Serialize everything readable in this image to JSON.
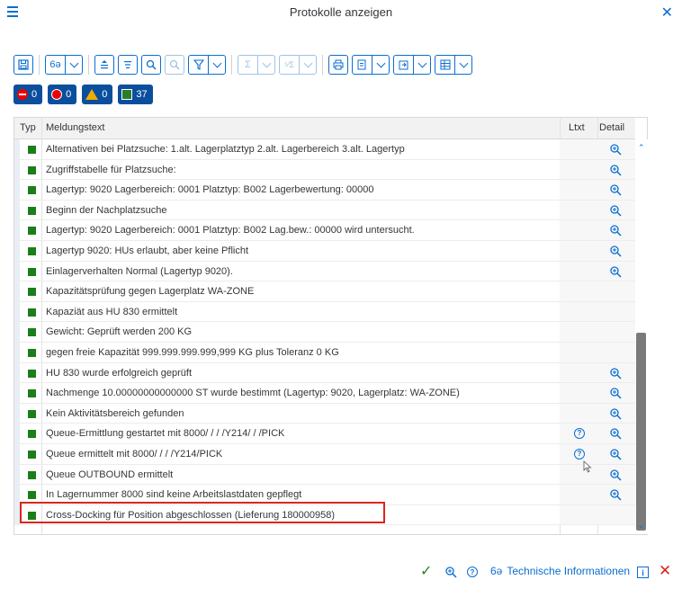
{
  "title": "Protokolle anzeigen",
  "icons": {
    "menu": "hamburger-menu-icon",
    "close": "close-icon",
    "detail": "magnifier-icon",
    "longtext": "help-circle-icon"
  },
  "status_counts": {
    "abort": "0",
    "error": "0",
    "warning": "0",
    "success": "37"
  },
  "table": {
    "headers": {
      "typ": "Typ",
      "text": "Meldungstext",
      "ltxt": "Ltxt",
      "detail": "Detail"
    },
    "rows": [
      {
        "text": "Alternativen bei Platzsuche: 1.alt. Lagerplatztyp 2.alt. Lagerbereich 3.alt. Lagertyp",
        "ltxt": false,
        "detail": true
      },
      {
        "text": "Zugriffstabelle für Platzsuche:",
        "ltxt": false,
        "detail": true
      },
      {
        "text": "Lagertyp: 9020 Lagerbereich: 0001 Platztyp: B002 Lagerbewertung: 00000",
        "ltxt": false,
        "detail": true
      },
      {
        "text": "Beginn der Nachplatzsuche",
        "ltxt": false,
        "detail": true
      },
      {
        "text": "Lagertyp: 9020 Lagerbereich: 0001 Platztyp: B002 Lag.bew.: 00000 wird untersucht.",
        "ltxt": false,
        "detail": true
      },
      {
        "text": "Lagertyp 9020: HUs erlaubt, aber keine Pflicht",
        "ltxt": false,
        "detail": true
      },
      {
        "text": "Einlagerverhalten Normal (Lagertyp 9020).",
        "ltxt": false,
        "detail": true
      },
      {
        "text": "Kapazitätsprüfung gegen Lagerplatz WA-ZONE",
        "ltxt": false,
        "detail": false
      },
      {
        "text": "Kapaziät aus HU 830 ermittelt",
        "ltxt": false,
        "detail": false
      },
      {
        "text": "Gewicht: Geprüft werden 200 KG",
        "ltxt": false,
        "detail": false
      },
      {
        "text": "gegen freie Kapazität 999.999.999.999,999 KG plus Toleranz 0 KG",
        "ltxt": false,
        "detail": false
      },
      {
        "text": "HU 830 wurde erfolgreich geprüft",
        "ltxt": false,
        "detail": true
      },
      {
        "text": "Nachmenge 10.00000000000000 ST wurde bestimmt (Lagertyp: 9020, Lagerplatz: WA-ZONE)",
        "ltxt": false,
        "detail": true
      },
      {
        "text": "Kein Aktivitätsbereich gefunden",
        "ltxt": false,
        "detail": true
      },
      {
        "text": "Queue-Ermittlung gestartet mit 8000/   /   /   /Y214/   /   /PICK",
        "ltxt": true,
        "detail": true
      },
      {
        "text": "Queue ermittelt mit 8000/   /   /   /Y214/PICK",
        "ltxt": true,
        "detail": true
      },
      {
        "text": "Queue OUTBOUND ermittelt",
        "ltxt": false,
        "detail": true
      },
      {
        "text": "In Lagernummer 8000 sind keine Arbeitslastdaten gepflegt",
        "ltxt": false,
        "detail": true
      },
      {
        "text": "Cross-Docking für Position abgeschlossen (Lieferung 180000958)",
        "ltxt": false,
        "detail": false
      }
    ]
  },
  "footer": {
    "tech_info": "Technische Informationen"
  },
  "colors": {
    "accent": "#0a6ed1",
    "success": "#1a7f1a",
    "highlight": "#d9261c",
    "status_bg": "#0a4f9e"
  }
}
